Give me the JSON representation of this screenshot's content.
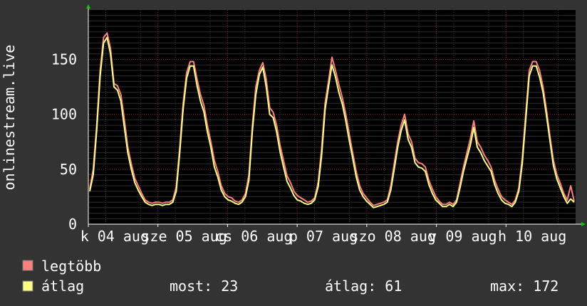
{
  "chart_data": {
    "type": "line",
    "ylabel": "onlinestream.live",
    "ylim": [
      0,
      195
    ],
    "yticks": [
      0,
      50,
      100,
      150
    ],
    "xticks": [
      "k 04 aug",
      "sze 05 aug",
      "cs 06 aug",
      "p 07 aug",
      "szo 08 aug",
      "v 09 aug",
      "h 10 aug"
    ],
    "grid": true,
    "series": [
      {
        "name": "legtöbb",
        "color": "#ff7f7f",
        "values": [
          32,
          50,
          90,
          140,
          170,
          174,
          160,
          128,
          126,
          118,
          95,
          70,
          55,
          42,
          35,
          28,
          22,
          20,
          19,
          20,
          20,
          19,
          20,
          20,
          22,
          34,
          70,
          110,
          138,
          148,
          148,
          132,
          118,
          108,
          90,
          75,
          58,
          48,
          35,
          28,
          25,
          24,
          21,
          20,
          22,
          28,
          45,
          90,
          125,
          140,
          147,
          132,
          106,
          102,
          90,
          72,
          58,
          44,
          38,
          30,
          26,
          24,
          22,
          20,
          21,
          24,
          38,
          68,
          110,
          130,
          152,
          140,
          127,
          115,
          100,
          82,
          65,
          48,
          35,
          28,
          24,
          20,
          17,
          18,
          19,
          20,
          22,
          35,
          55,
          75,
          90,
          100,
          82,
          75,
          60,
          56,
          55,
          52,
          40,
          32,
          25,
          21,
          18,
          18,
          20,
          18,
          22,
          37,
          52,
          65,
          78,
          94,
          75,
          70,
          63,
          58,
          52,
          40,
          32,
          25,
          22,
          20,
          18,
          22,
          33,
          60,
          100,
          140,
          148,
          148,
          140,
          125,
          104,
          80,
          58,
          45,
          37,
          28,
          22,
          35,
          21
        ]
      },
      {
        "name": "átlag",
        "color": "#ffff7f",
        "values": [
          30,
          45,
          85,
          135,
          165,
          170,
          155,
          125,
          122,
          112,
          88,
          65,
          50,
          38,
          31,
          25,
          20,
          18,
          17,
          18,
          18,
          17,
          18,
          18,
          20,
          30,
          65,
          105,
          133,
          144,
          144,
          126,
          112,
          102,
          84,
          70,
          52,
          43,
          31,
          25,
          22,
          21,
          19,
          18,
          20,
          25,
          40,
          85,
          118,
          136,
          143,
          125,
          100,
          97,
          84,
          66,
          52,
          39,
          33,
          26,
          22,
          21,
          19,
          18,
          19,
          22,
          34,
          62,
          104,
          125,
          145,
          134,
          120,
          109,
          94,
          76,
          60,
          43,
          31,
          25,
          21,
          18,
          15,
          16,
          17,
          18,
          20,
          31,
          50,
          70,
          85,
          95,
          77,
          70,
          56,
          52,
          51,
          48,
          36,
          28,
          22,
          19,
          16,
          16,
          18,
          16,
          20,
          33,
          48,
          60,
          72,
          88,
          70,
          65,
          58,
          53,
          48,
          36,
          28,
          22,
          19,
          18,
          16,
          20,
          30,
          55,
          95,
          135,
          144,
          144,
          134,
          120,
          99,
          76,
          53,
          41,
          33,
          25,
          19,
          23,
          20
        ]
      }
    ],
    "legend": [
      {
        "label": "legtöbb",
        "color": "#ff7f7f"
      },
      {
        "label": "átlag",
        "color": "#ffff7f"
      }
    ]
  },
  "stats": {
    "most": "most: 23",
    "atlag": "átlag: 61",
    "max": "max: 172"
  }
}
